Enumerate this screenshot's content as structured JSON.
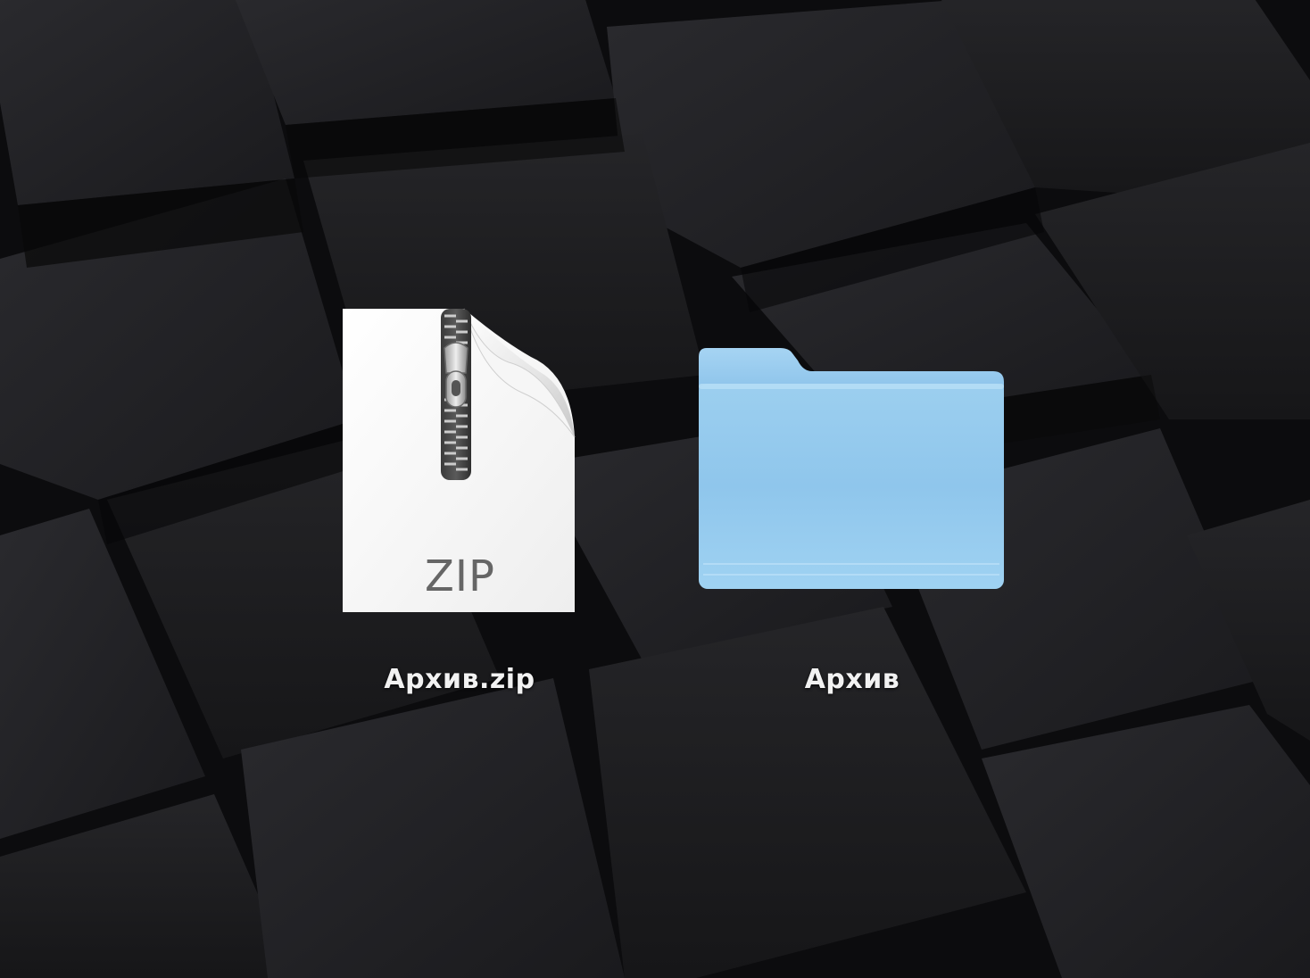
{
  "desktop": {
    "icons": [
      {
        "label": "Архив.zip",
        "icon": "zip-archive-icon",
        "badge": "ZIP"
      },
      {
        "label": "Архив",
        "icon": "folder-icon"
      }
    ]
  },
  "colors": {
    "background": "#0f0f11",
    "folder_blue": "#9ccfef",
    "label_text": "#f2f2f2",
    "zip_badge_text": "#666666"
  }
}
